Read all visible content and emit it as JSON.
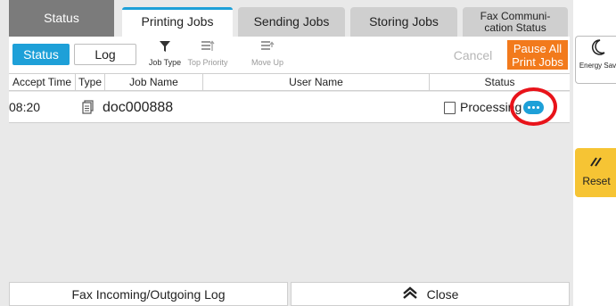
{
  "tabs": {
    "status": "Status",
    "printing": "Printing Jobs",
    "sending": "Sending Jobs",
    "storing": "Storing Jobs",
    "fax": "Fax Communi-\ncation Status"
  },
  "subtabs": {
    "status": "Status",
    "log": "Log"
  },
  "tools": {
    "job_type": "Job Type",
    "top_priority": "Top Priority",
    "move_up": "Move Up"
  },
  "actions": {
    "cancel": "Cancel",
    "pause_all": "Pause All\nPrint Jobs"
  },
  "columns": {
    "accept_time": "Accept Time",
    "type": "Type",
    "job_name": "Job Name",
    "user_name": "User Name",
    "status": "Status"
  },
  "jobs": [
    {
      "accept_time": "08:20",
      "job_name": "doc000888",
      "user_name": "",
      "status": "Processing"
    }
  ],
  "bottom": {
    "fax_log": "Fax Incoming/Outgoing Log",
    "close": "Close"
  },
  "side": {
    "energy": "Energy Sav",
    "reset": "Reset"
  },
  "colors": {
    "accent": "#1ea0d8",
    "pause": "#f27a1c",
    "reset": "#f6c434",
    "highlight": "#e8131a"
  }
}
